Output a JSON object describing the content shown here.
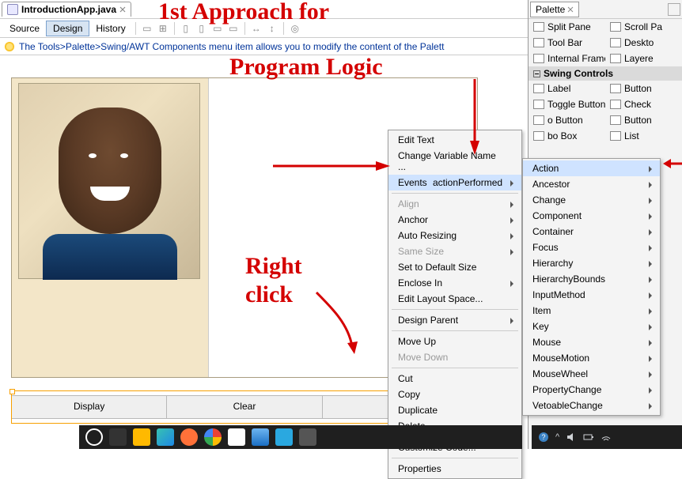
{
  "tab": {
    "file_icon": "java-class-icon",
    "title": "IntroductionApp.java",
    "close": "×"
  },
  "toolbar": {
    "modes": {
      "source": "Source",
      "design": "Design",
      "history": "History"
    }
  },
  "tip": "The Tools>Palette>Swing/AWT Components menu item allows you to modify the content of the Palett",
  "design": {
    "buttons": [
      "Display",
      "Clear",
      ""
    ]
  },
  "context_menu": {
    "edit_text": "Edit Text",
    "change_var": "Change Variable Name ...",
    "events": "Events",
    "events_sub_label": "actionPerformed",
    "align": "Align",
    "anchor": "Anchor",
    "auto_resizing": "Auto Resizing",
    "same_size": "Same Size",
    "set_default": "Set to Default Size",
    "enclose": "Enclose In",
    "edit_layout": "Edit Layout Space...",
    "design_parent": "Design Parent",
    "move_up": "Move Up",
    "move_down": "Move Down",
    "cut": "Cut",
    "copy": "Copy",
    "duplicate": "Duplicate",
    "delete": "Delete",
    "customize": "Customize Code...",
    "properties": "Properties"
  },
  "events_submenu": [
    "Action",
    "Ancestor",
    "Change",
    "Component",
    "Container",
    "Focus",
    "Hierarchy",
    "HierarchyBounds",
    "InputMethod",
    "Item",
    "Key",
    "Mouse",
    "MouseMotion",
    "MouseWheel",
    "PropertyChange",
    "VetoableChange"
  ],
  "palette": {
    "title": "Palette",
    "items_top": [
      [
        "Split Pane",
        "Scroll Pa"
      ],
      [
        "Tool Bar",
        "Deskto"
      ],
      [
        "Internal Frame",
        "Layere"
      ]
    ],
    "section": "Swing Controls",
    "items": [
      [
        "Label",
        "Button"
      ],
      [
        "Toggle Button",
        "Check"
      ],
      [
        "o Button",
        "Button"
      ],
      [
        "bo Box",
        "List"
      ]
    ]
  },
  "annotations": {
    "title1": "1st Approach for",
    "title2": "Program Logic",
    "right_click1": "Right",
    "right_click2": "click"
  },
  "tray": {
    "up": "^"
  }
}
